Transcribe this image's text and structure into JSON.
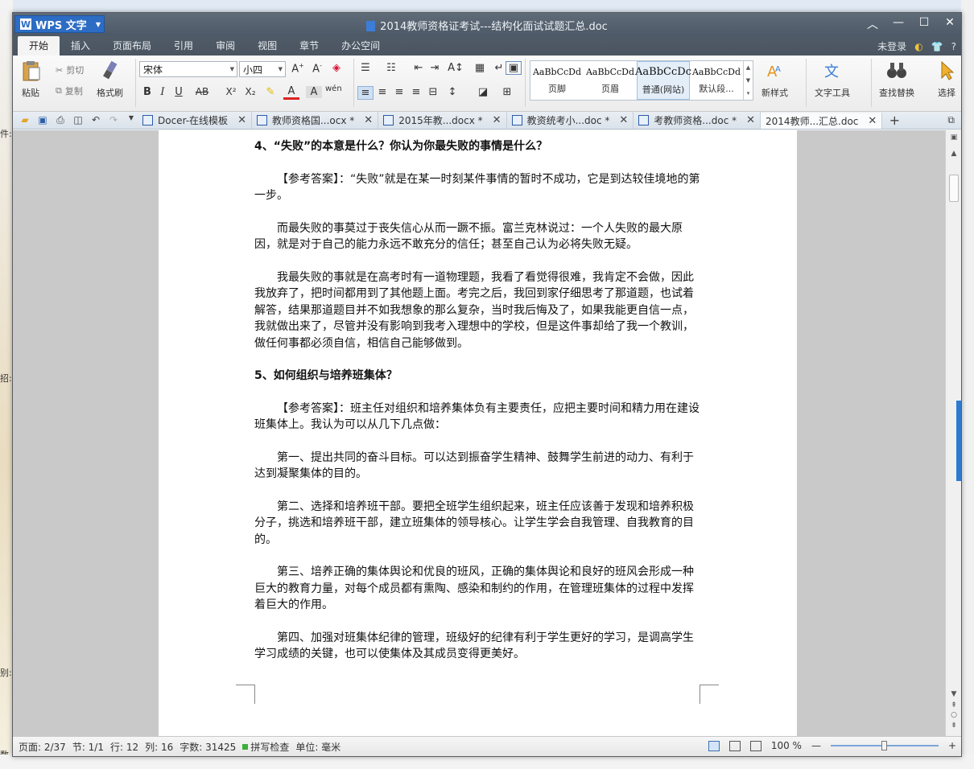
{
  "window": {
    "app_name": "WPS 文字",
    "title": "2014教师资格证考试---结构化面试试题汇总.doc"
  },
  "menu": {
    "tabs": [
      "开始",
      "插入",
      "页面布局",
      "引用",
      "审阅",
      "视图",
      "章节",
      "办公空间"
    ],
    "active": "开始",
    "login": "未登录",
    "help": "?"
  },
  "ribbon": {
    "paste": "粘贴",
    "cut": "剪切",
    "copy": "复制",
    "format_painter": "格式刷",
    "font_name": "宋体",
    "font_size": "小四",
    "bold": "B",
    "italic": "I",
    "underline": "U",
    "strike": "AB",
    "superscript": "X²",
    "subscript": "X₂",
    "styles": [
      {
        "sample": "AaBbCcDd",
        "name": "页脚"
      },
      {
        "sample": "AaBbCcDd",
        "name": "页眉"
      },
      {
        "sample": "AaBbCcDc",
        "name": "普通(网站)"
      },
      {
        "sample": "AaBbCcDd",
        "name": "默认段..."
      }
    ],
    "new_style": "新样式",
    "text_tools": "文字工具",
    "find_replace": "查找替换",
    "select": "选择"
  },
  "doc_tabs": [
    {
      "label": "Docer-在线模板",
      "active": false
    },
    {
      "label": "教师资格国...ocx *",
      "active": false
    },
    {
      "label": "2015年教...docx *",
      "active": false
    },
    {
      "label": "教资统考小...doc *",
      "active": false
    },
    {
      "label": "考教师资格...doc *",
      "active": false
    },
    {
      "label": "2014教师...汇总.doc",
      "active": true
    }
  ],
  "document": {
    "q4_title": "4、“失败”的本意是什么？你认为你最失败的事情是什么？",
    "q4_p1": "【参考答案】：“失败”就是在某一时刻某件事情的暂时不成功，它是到达较佳境地的第一步。",
    "q4_p2": "而最失败的事莫过于丧失信心从而一蹶不振。富兰克林说过：一个人失败的最大原因，就是对于自己的能力永远不敢充分的信任；甚至自己认为必将失败无疑。",
    "q4_p3": "我最失败的事就是在高考时有一道物理题，我看了看觉得很难，我肯定不会做，因此我放弃了，把时间都用到了其他题上面。考完之后，我回到家仔细思考了那道题，也试着解答，结果那道题目并不如我想象的那么复杂，当时我后悔及了，如果我能更自信一点，我就做出来了，尽管并没有影响到我考入理想中的学校，但是这件事却给了我一个教训，做任何事都必须自信，相信自己能够做到。",
    "q5_title": "5、如何组织与培养班集体？",
    "q5_p1": "【参考答案】：班主任对组织和培养集体负有主要责任，应把主要时间和精力用在建设班集体上。我认为可以从几下几点做：",
    "q5_p2": "第一、提出共同的奋斗目标。可以达到振奋学生精神、鼓舞学生前进的动力、有利于达到凝聚集体的目的。",
    "q5_p3": "第二、选择和培养班干部。要把全班学生组织起来，班主任应该善于发现和培养积极分子，挑选和培养班干部，建立班集体的领导核心。让学生学会自我管理、自我教育的目的。",
    "q5_p4": "第三、培养正确的集体舆论和优良的班风，正确的集体舆论和良好的班风会形成一种巨大的教育力量，对每个成员都有熏陶、感染和制约的作用，在管理班集体的过程中发挥着巨大的作用。",
    "q5_p5": "第四、加强对班集体纪律的管理，班级好的纪律有利于学生更好的学习，是调高学生学习成绩的关键，也可以使集体及其成员变得更美好。"
  },
  "status": {
    "page": "页面: 2/37",
    "section": "节: 1/1",
    "row": "行: 12",
    "col": "列: 16",
    "words": "字数: 31425",
    "spell": "拼写检查",
    "unit": "单位: 毫米",
    "zoom": "100 %",
    "zoom_level": 0.5
  },
  "background": {
    "left_fragments": [
      "件:",
      "招:",
      "别:",
      "数"
    ]
  }
}
